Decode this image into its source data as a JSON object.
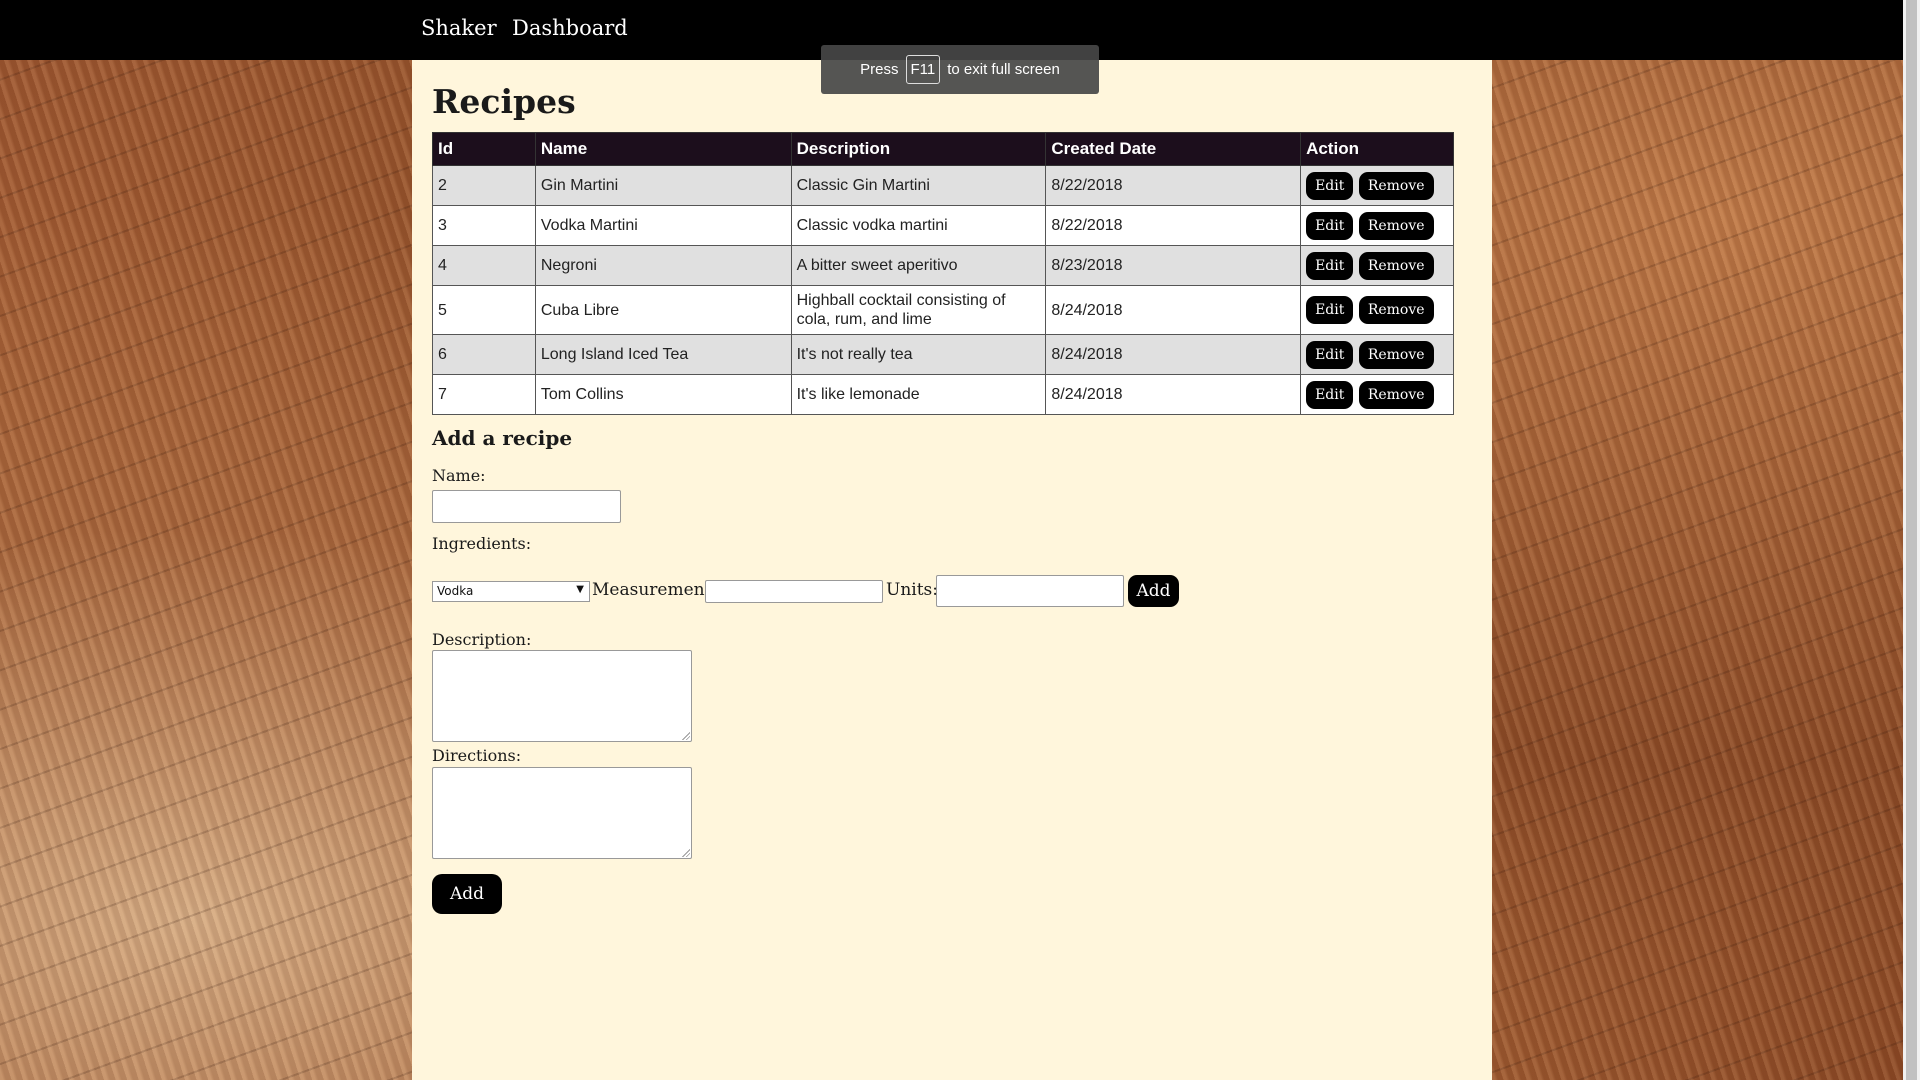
{
  "nav": {
    "brand": "Shaker",
    "dashboard": "Dashboard"
  },
  "fullscreen_toast": {
    "prefix": "Press",
    "key": "F11",
    "suffix": "to exit full screen"
  },
  "page": {
    "title": "Recipes"
  },
  "table": {
    "headers": {
      "id": "Id",
      "name": "Name",
      "description": "Description",
      "created": "Created Date",
      "action": "Action"
    },
    "rows": [
      {
        "id": "2",
        "name": "Gin Martini",
        "description": "Classic Gin Martini",
        "created": "8/22/2018"
      },
      {
        "id": "3",
        "name": "Vodka Martini",
        "description": "Classic vodka martini",
        "created": "8/22/2018"
      },
      {
        "id": "4",
        "name": "Negroni",
        "description": "A bitter sweet aperitivo",
        "created": "8/23/2018"
      },
      {
        "id": "5",
        "name": "Cuba Libre",
        "description": "Highball cocktail consisting of cola, rum, and lime",
        "created": "8/24/2018"
      },
      {
        "id": "6",
        "name": "Long Island Iced Tea",
        "description": "It's not really tea",
        "created": "8/24/2018"
      },
      {
        "id": "7",
        "name": "Tom Collins",
        "description": "It's like lemonade",
        "created": "8/24/2018"
      }
    ],
    "edit_label": "Edit",
    "remove_label": "Remove"
  },
  "form": {
    "title": "Add a recipe",
    "name_label": "Name:",
    "name_value": "",
    "ingredients_label": "Ingredients:",
    "ingredient_selected": "Vodka",
    "measurement_label": "Measurement:",
    "measurement_value": "",
    "units_label": "Units:",
    "units_value": "",
    "add_ingredient_label": "Add",
    "description_label": "Description:",
    "directions_label": "Directions:",
    "add_recipe_label": "Add"
  }
}
